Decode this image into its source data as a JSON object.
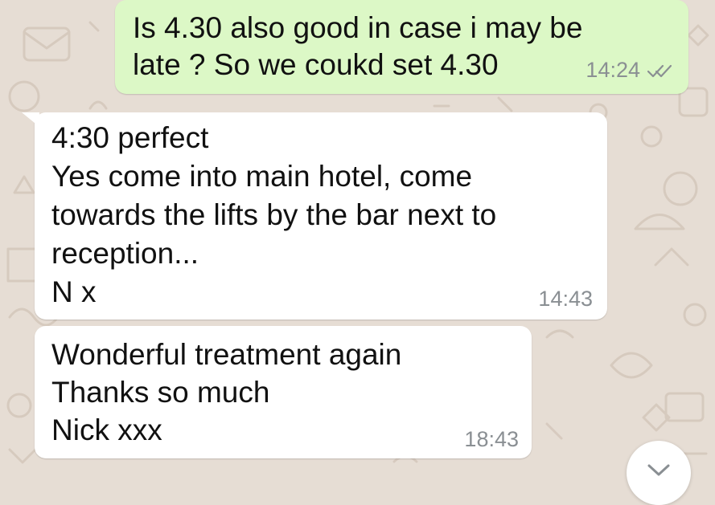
{
  "messages": [
    {
      "direction": "outgoing",
      "lines": [
        "Is 4.30 also good in case i may be",
        "late ? So we coukd set 4.30"
      ],
      "time": "14:24",
      "read_receipt": "double-check-icon"
    },
    {
      "direction": "incoming",
      "lines": [
        "4:30 perfect",
        "Yes come into main hotel, come",
        "towards the lifts by the bar next to",
        "reception...",
        "N x"
      ],
      "time": "14:43"
    },
    {
      "direction": "incoming",
      "lines": [
        "Wonderful treatment again",
        "Thanks so much",
        "Nick xxx"
      ],
      "time": "18:43"
    }
  ],
  "controls": {
    "scroll_button_icon": "chevron-down-icon"
  },
  "colors": {
    "outgoing_bubble": "#dcf8c6",
    "incoming_bubble": "#ffffff",
    "wallpaper": "#e6ddd4",
    "meta_text": "#8a8f93"
  }
}
